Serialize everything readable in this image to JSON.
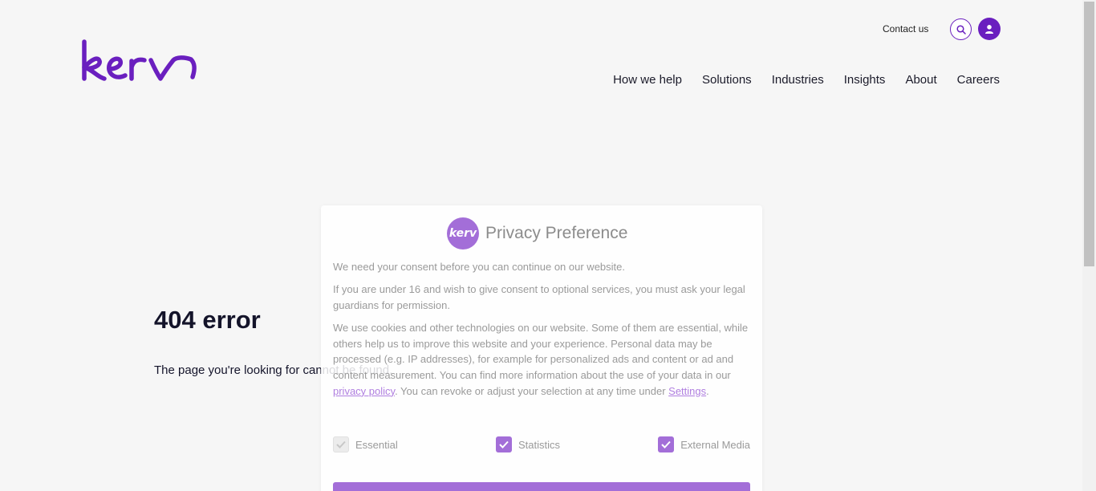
{
  "header": {
    "logo_text": "kerv",
    "contact_label": "Contact us",
    "nav": [
      {
        "label": "How we help"
      },
      {
        "label": "Solutions"
      },
      {
        "label": "Industries"
      },
      {
        "label": "Insights"
      },
      {
        "label": "About"
      },
      {
        "label": "Careers"
      }
    ]
  },
  "error": {
    "title": "404 error",
    "message": "The page you're looking for cannot be found."
  },
  "privacy": {
    "logo_text": "kerv",
    "title": "Privacy Preference",
    "p1": "We need your consent before you can continue on our website.",
    "p2": "If you are under 16 and wish to give consent to optional services, you must ask your legal guardians for permission.",
    "p3_before": "We use cookies and other technologies on our website. Some of them are essential, while others help us to improve this website and your experience. Personal data may be processed (e.g. IP addresses), for example for personalized ads and content or ad and content measurement. You can find more information about the use of your data in our ",
    "privacy_link": "privacy policy",
    "p3_middle": ". You can revoke or adjust your selection at any time under ",
    "settings_link": "Settings",
    "p3_after": ".",
    "checkboxes": [
      {
        "label": "Essential",
        "checked": true,
        "disabled": true
      },
      {
        "label": "Statistics",
        "checked": true,
        "disabled": false
      },
      {
        "label": "External Media",
        "checked": true,
        "disabled": false
      }
    ]
  },
  "colors": {
    "brand": "#6a1fbf",
    "brand_light": "#a36ed8",
    "background": "#f6f6f6"
  }
}
